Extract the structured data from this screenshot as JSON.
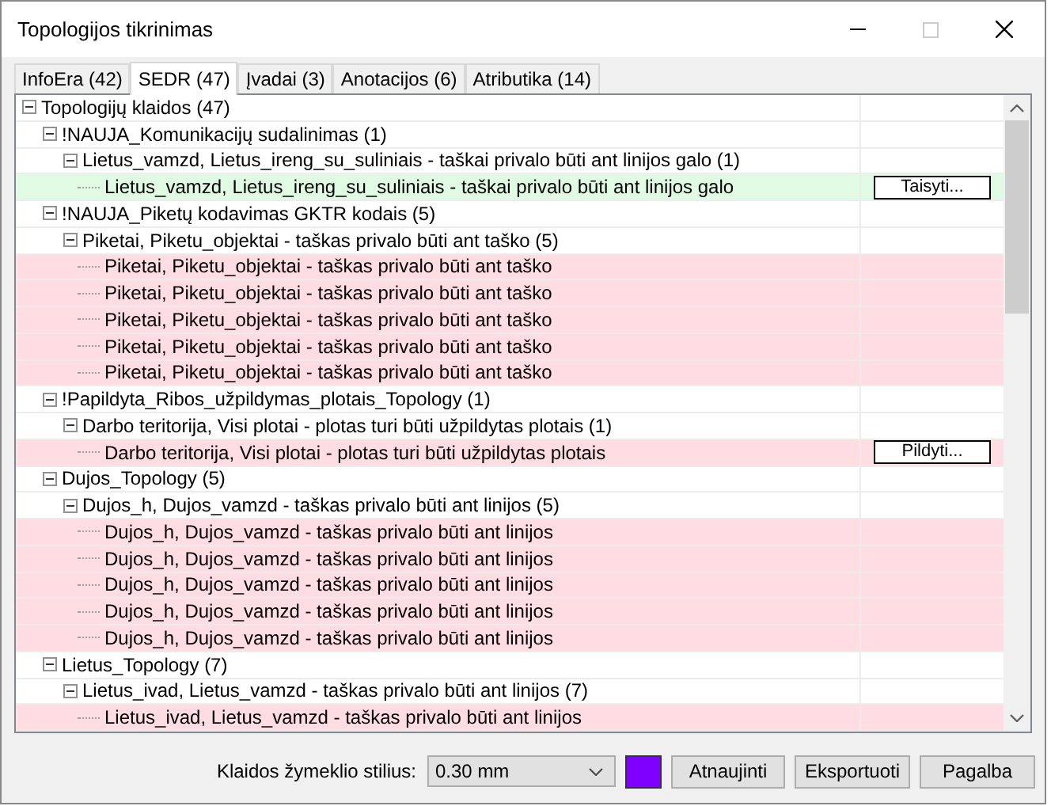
{
  "window": {
    "title": "Topologijos tikrinimas"
  },
  "tabs": [
    {
      "label": "InfoEra (42)",
      "selected": false
    },
    {
      "label": "SEDR (47)",
      "selected": true
    },
    {
      "label": "Įvadai (3)",
      "selected": false
    },
    {
      "label": "Anotacijos (6)",
      "selected": false
    },
    {
      "label": "Atributika (14)",
      "selected": false
    }
  ],
  "tree": [
    {
      "label": "Topologijų klaidos (47)",
      "expanded": true,
      "children": [
        {
          "label": "!NAUJA_Komunikacijų sudalinimas (1)",
          "expanded": true,
          "children": [
            {
              "label": "Lietus_vamzd, Lietus_ireng_su_suliniais - taškai privalo būti ant linijos galo (1)",
              "expanded": true,
              "children": [
                {
                  "label": "Lietus_vamzd, Lietus_ireng_su_suliniais - taškai privalo būti ant linijos galo",
                  "color": "#e0fae3",
                  "action": "Taisyti..."
                }
              ]
            }
          ]
        },
        {
          "label": "!NAUJA_Piketų kodavimas GKTR kodais (5)",
          "expanded": true,
          "children": [
            {
              "label": "Piketai, Piketu_objektai - taškas privalo būti ant taško (5)",
              "expanded": true,
              "children": [
                {
                  "label": "Piketai, Piketu_objektai - taškas privalo būti ant taško",
                  "color": "#ffdde2"
                },
                {
                  "label": "Piketai, Piketu_objektai - taškas privalo būti ant taško",
                  "color": "#ffdde2"
                },
                {
                  "label": "Piketai, Piketu_objektai - taškas privalo būti ant taško",
                  "color": "#ffdde2"
                },
                {
                  "label": "Piketai, Piketu_objektai - taškas privalo būti ant taško",
                  "color": "#ffdde2"
                },
                {
                  "label": "Piketai, Piketu_objektai - taškas privalo būti ant taško",
                  "color": "#ffdde2"
                }
              ]
            }
          ]
        },
        {
          "label": "!Papildyta_Ribos_užpildymas_plotais_Topology (1)",
          "expanded": true,
          "children": [
            {
              "label": "Darbo teritorija, Visi plotai - plotas turi būti užpildytas plotais (1)",
              "expanded": true,
              "children": [
                {
                  "label": "Darbo teritorija, Visi plotai - plotas turi būti užpildytas plotais",
                  "color": "#ffdde2",
                  "action": "Pildyti..."
                }
              ]
            }
          ]
        },
        {
          "label": "Dujos_Topology (5)",
          "expanded": true,
          "children": [
            {
              "label": "Dujos_h, Dujos_vamzd - taškas privalo būti ant linijos (5)",
              "expanded": true,
              "children": [
                {
                  "label": "Dujos_h, Dujos_vamzd - taškas privalo būti ant linijos",
                  "color": "#ffdde2"
                },
                {
                  "label": "Dujos_h, Dujos_vamzd - taškas privalo būti ant linijos",
                  "color": "#ffdde2"
                },
                {
                  "label": "Dujos_h, Dujos_vamzd - taškas privalo būti ant linijos",
                  "color": "#ffdde2"
                },
                {
                  "label": "Dujos_h, Dujos_vamzd - taškas privalo būti ant linijos",
                  "color": "#ffdde2"
                },
                {
                  "label": "Dujos_h, Dujos_vamzd - taškas privalo būti ant linijos",
                  "color": "#ffdde2"
                }
              ]
            }
          ]
        },
        {
          "label": "Lietus_Topology (7)",
          "expanded": true,
          "children": [
            {
              "label": "Lietus_ivad, Lietus_vamzd - taškas privalo būti ant linijos (7)",
              "expanded": true,
              "children": [
                {
                  "label": "Lietus_ivad, Lietus_vamzd - taškas privalo būti ant linijos",
                  "color": "#ffdde2"
                }
              ]
            }
          ]
        }
      ]
    }
  ],
  "footer": {
    "label": "Klaidos žymeklio stilius:",
    "style_value": "0.30 mm",
    "marker": {
      "color": "#8000ff"
    },
    "buttons": [
      "Atnaujinti",
      "Eksportuoti",
      "Pagalba"
    ]
  }
}
